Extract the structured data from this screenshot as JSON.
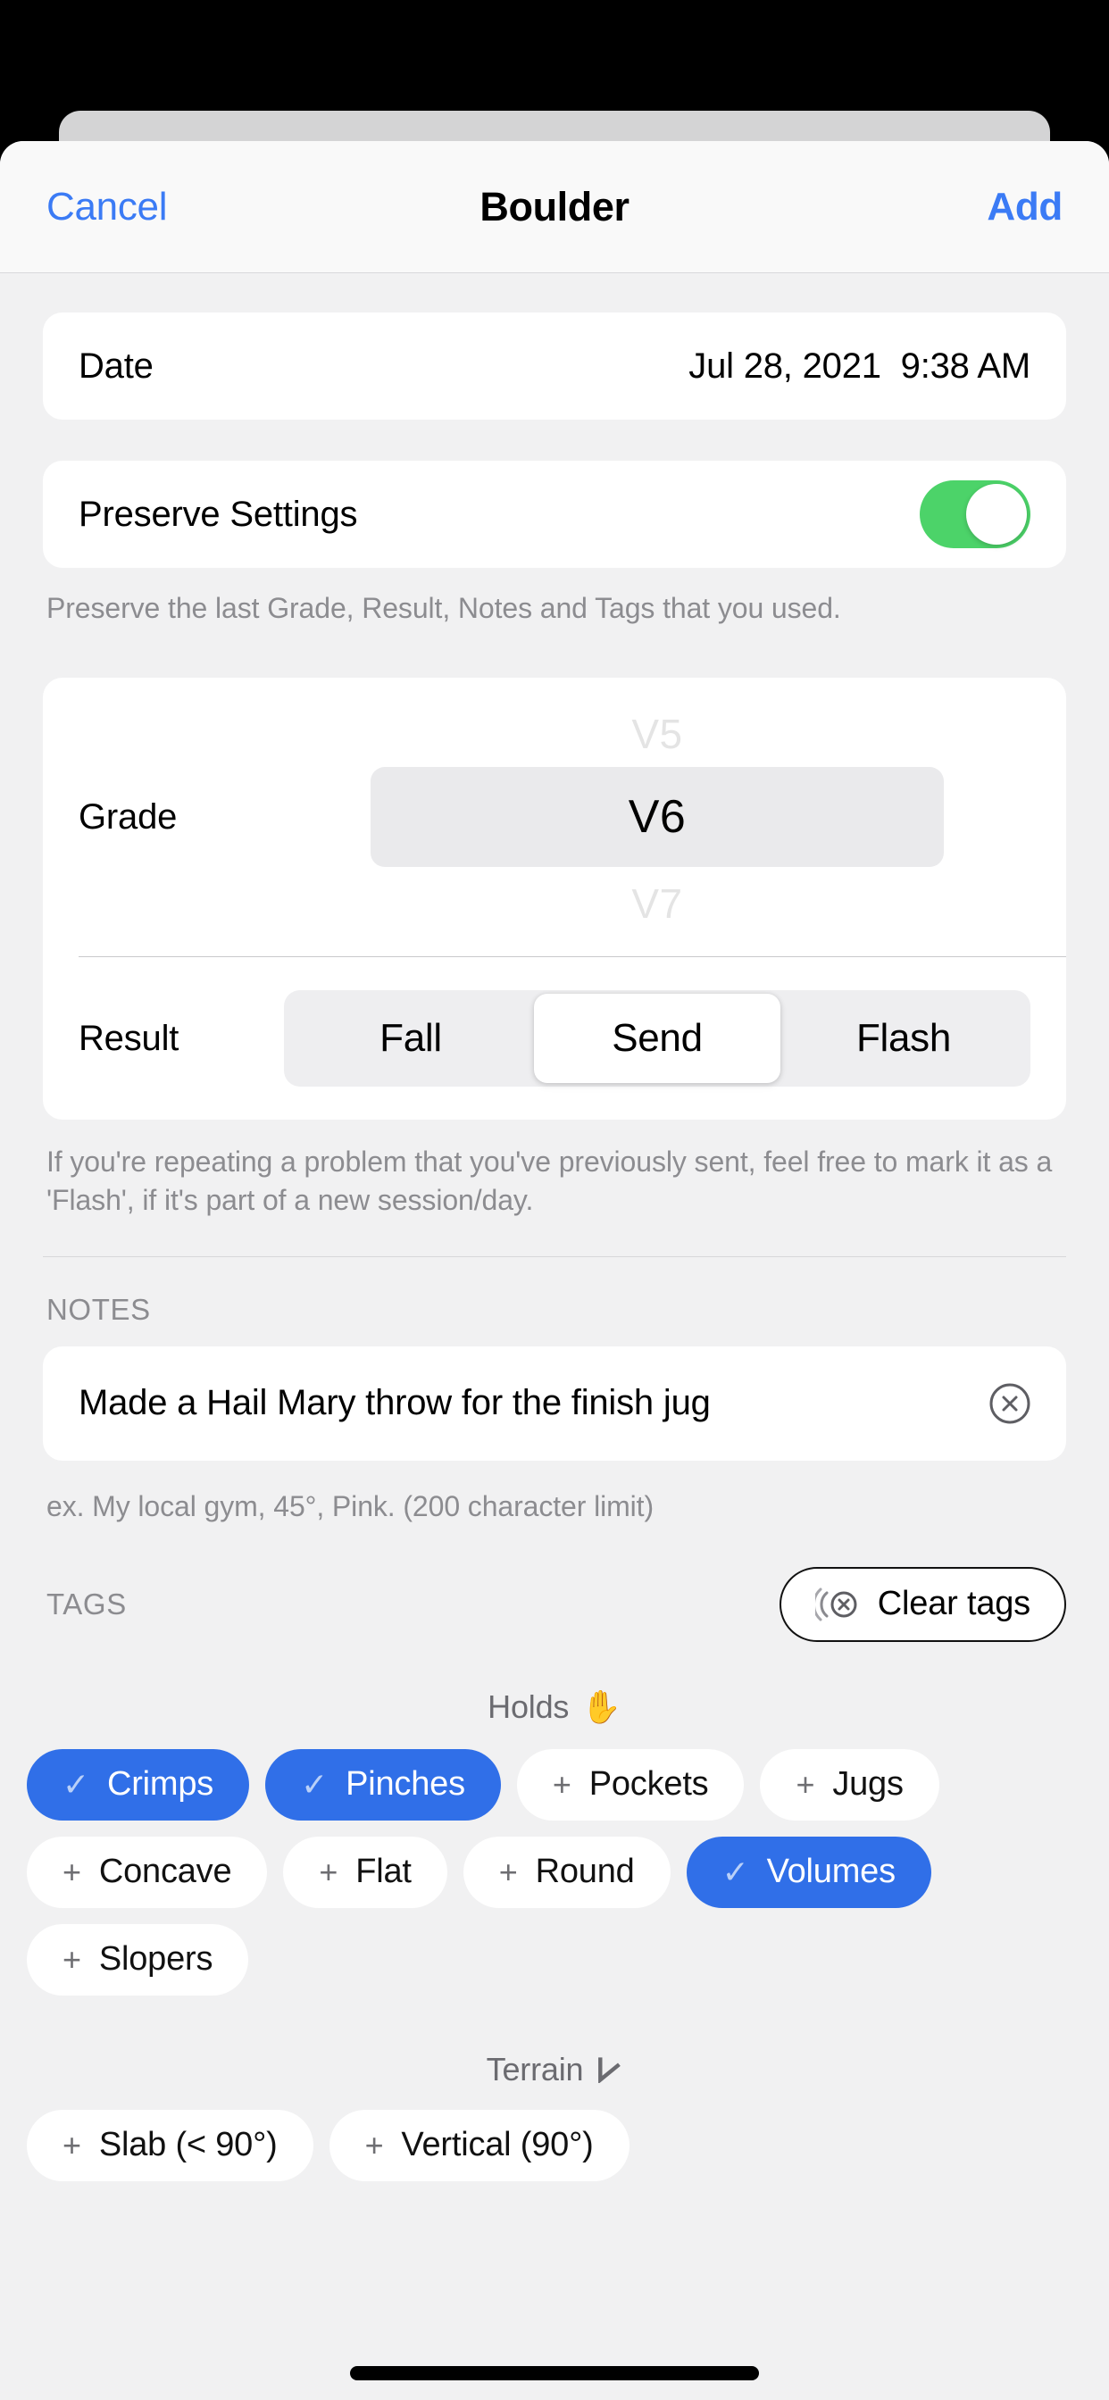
{
  "navbar": {
    "cancel_label": "Cancel",
    "title": "Boulder",
    "add_label": "Add"
  },
  "date_row": {
    "label": "Date",
    "value": "Jul 28, 2021  9:38 AM"
  },
  "preserve_row": {
    "label": "Preserve Settings",
    "toggle_state": "on",
    "footnote": "Preserve the last Grade, Result, Notes and Tags that you used."
  },
  "grade": {
    "label": "Grade",
    "previous": "V5",
    "selected": "V6",
    "next": "V7"
  },
  "result": {
    "label": "Result",
    "options": [
      "Fall",
      "Send",
      "Flash"
    ],
    "selected": "Send",
    "footnote": "If you're repeating a problem that you've previously sent, feel free to mark it as a 'Flash', if it's part of a new session/day."
  },
  "notes": {
    "section_label": "NOTES",
    "value": "Made a Hail Mary throw for the finish jug",
    "placeholder": "ex. My local gym, 45°, Pink. (200 character limit)",
    "hint": "ex. My local gym, 45°, Pink. (200 character limit)",
    "clear_icon": "clear-circle-icon"
  },
  "tags": {
    "section_label": "TAGS",
    "clear_button_label": "Clear tags",
    "clear_button_icon": "clear-tags-icon",
    "groups": [
      {
        "title": "Holds",
        "icon": "✋",
        "icon_name": "raised-hand-icon",
        "chips": [
          {
            "label": "Crimps",
            "selected": true,
            "mark": "✓"
          },
          {
            "label": "Pinches",
            "selected": true,
            "mark": "✓"
          },
          {
            "label": "Pockets",
            "selected": false,
            "mark": "+"
          },
          {
            "label": "Jugs",
            "selected": false,
            "mark": "+"
          },
          {
            "label": "Concave",
            "selected": false,
            "mark": "+"
          },
          {
            "label": "Flat",
            "selected": false,
            "mark": "+"
          },
          {
            "label": "Round",
            "selected": false,
            "mark": "+"
          },
          {
            "label": "Volumes",
            "selected": true,
            "mark": "✓"
          },
          {
            "label": "Slopers",
            "selected": false,
            "mark": "+"
          }
        ]
      },
      {
        "title": "Terrain",
        "icon": "⊿",
        "icon_name": "angle-slope-icon",
        "chips": [
          {
            "label": "Slab (< 90°)",
            "selected": false,
            "mark": "+"
          },
          {
            "label": "Vertical (90°)",
            "selected": false,
            "mark": "+"
          }
        ]
      }
    ]
  },
  "colors": {
    "accent_blue": "#3b7bf5",
    "chip_selected_blue": "#306fe8",
    "toggle_green": "#4cd369",
    "sheet_background": "#f1f1f2",
    "card_white": "#ffffff",
    "muted_text": "#8c8c90"
  }
}
